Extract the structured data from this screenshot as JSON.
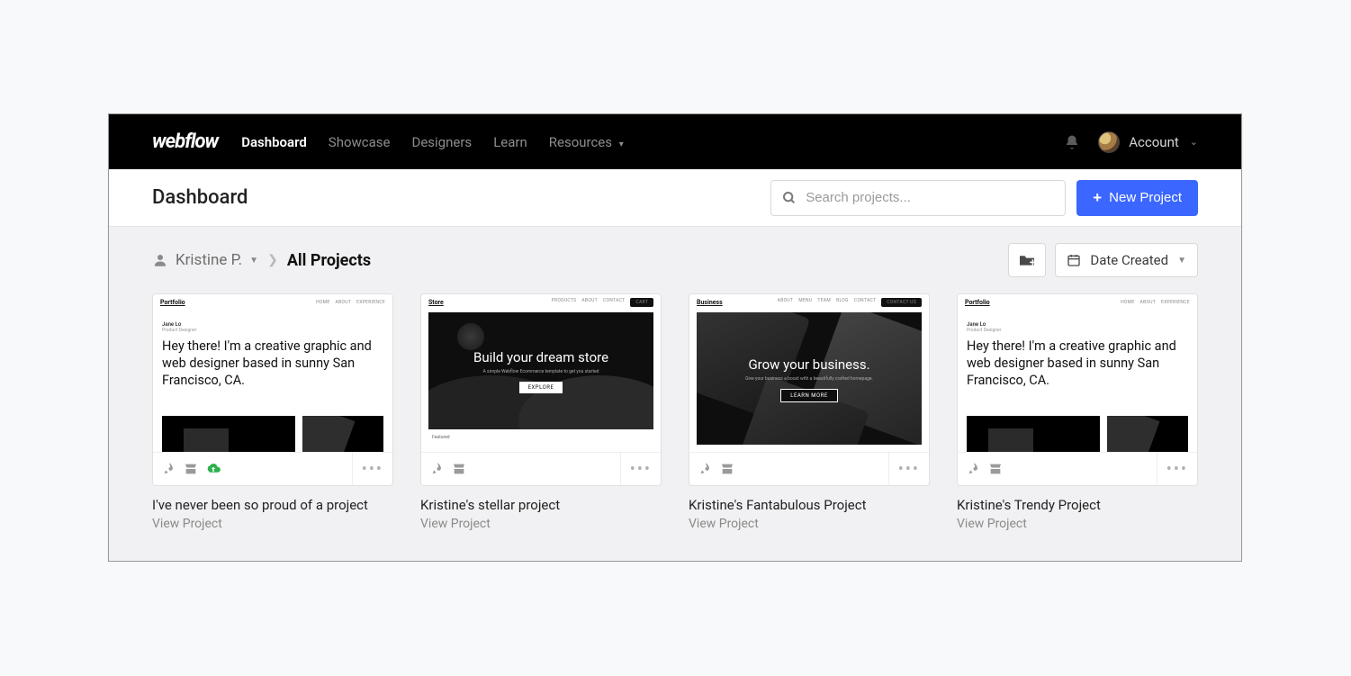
{
  "brand": "webflow",
  "nav": {
    "items": [
      {
        "label": "Dashboard",
        "active": true
      },
      {
        "label": "Showcase",
        "active": false
      },
      {
        "label": "Designers",
        "active": false
      },
      {
        "label": "Learn",
        "active": false
      },
      {
        "label": "Resources",
        "active": false,
        "dropdown": true
      }
    ],
    "account_label": "Account"
  },
  "subheader": {
    "title": "Dashboard",
    "search_placeholder": "Search projects...",
    "new_project_label": "New Project"
  },
  "breadcrumb": {
    "user": "Kristine P.",
    "current": "All Projects",
    "sort_label": "Date Created"
  },
  "projects": [
    {
      "title": "I've never been so proud of a project",
      "link_label": "View Project",
      "thumb_type": "portfolio",
      "thumb": {
        "header_name": "Portfolio",
        "menu": [
          "HOME",
          "ABOUT",
          "EXPERIENCE"
        ],
        "name": "Jane Lo",
        "subtitle": "Product Designer",
        "body": "Hey there! I'm a creative graphic and web designer based in sunny San Francisco, CA."
      },
      "has_cloud": true
    },
    {
      "title": "Kristine's stellar project",
      "link_label": "View Project",
      "thumb_type": "store",
      "thumb": {
        "header_name": "Store",
        "menu": [
          "PRODUCTS",
          "ABOUT",
          "CONTACT"
        ],
        "hero_title": "Build your dream store",
        "hero_sub": "A simple Webflow Ecommerce template to get you started",
        "hero_btn": "EXPLORE"
      },
      "has_cloud": false
    },
    {
      "title": "Kristine's Fantabulous Project",
      "link_label": "View Project",
      "thumb_type": "business",
      "thumb": {
        "header_name": "Business",
        "menu": [
          "ABOUT",
          "MENU",
          "TEAM",
          "BLOG",
          "CONTACT"
        ],
        "hero_title": "Grow your business.",
        "hero_sub": "Give your business a boost with a beautifully crafted homepage.",
        "hero_btn": "LEARN MORE"
      },
      "has_cloud": false
    },
    {
      "title": "Kristine's Trendy Project",
      "link_label": "View Project",
      "thumb_type": "portfolio",
      "thumb": {
        "header_name": "Portfolio",
        "menu": [
          "HOME",
          "ABOUT",
          "EXPERIENCE"
        ],
        "name": "Jane Lo",
        "subtitle": "Product Designer",
        "body": "Hey there! I'm a creative graphic and web designer based in sunny San Francisco, CA."
      },
      "has_cloud": false
    }
  ]
}
